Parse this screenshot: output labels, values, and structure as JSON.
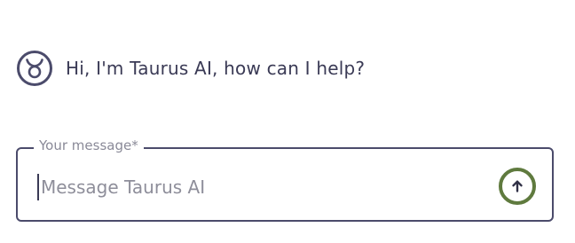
{
  "assistant": {
    "logo_icon": "taurus-sign-icon",
    "greeting": "Hi, I'm Taurus AI, how can I help?"
  },
  "composer": {
    "label": "Your message*",
    "placeholder": "Message Taurus AI",
    "value": "",
    "send_icon": "arrow-up-icon",
    "send_ring_color": "#5f7a3e",
    "border_color": "#4b4b6b"
  }
}
